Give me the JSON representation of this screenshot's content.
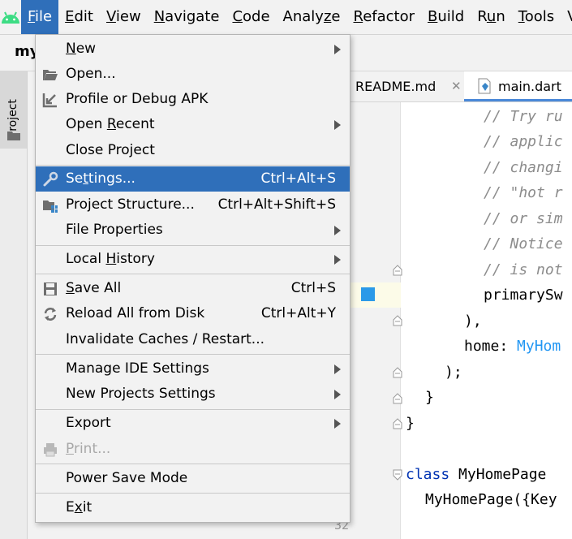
{
  "menubar": {
    "items": [
      {
        "pre": "",
        "mn": "F",
        "post": "ile"
      },
      {
        "pre": "",
        "mn": "E",
        "post": "dit"
      },
      {
        "pre": "",
        "mn": "V",
        "post": "iew"
      },
      {
        "pre": "",
        "mn": "N",
        "post": "avigate"
      },
      {
        "pre": "",
        "mn": "C",
        "post": "ode"
      },
      {
        "pre": "Analy",
        "mn": "z",
        "post": "e"
      },
      {
        "pre": "",
        "mn": "R",
        "post": "efactor"
      },
      {
        "pre": "",
        "mn": "B",
        "post": "uild"
      },
      {
        "pre": "R",
        "mn": "u",
        "post": "n"
      },
      {
        "pre": "",
        "mn": "T",
        "post": "ools"
      },
      {
        "pre": "VC",
        "mn": "",
        "post": ""
      }
    ]
  },
  "toolbar": {
    "project_name": "my"
  },
  "tool_strip": {
    "project_tab": "Project"
  },
  "tabs": {
    "readme": "README.md",
    "readme_close": "✕",
    "main": "main.dart"
  },
  "gutter": {
    "line_numbers": [
      "32"
    ]
  },
  "code": {
    "lines": [
      "// Try ru",
      "// applic",
      "// changi",
      "// \"hot r",
      "// or sim",
      "// Notice",
      "// is not",
      "primarySw",
      "),",
      "home: ",
      ");",
      "}",
      "}",
      "class",
      " MyHomePage",
      "MyHomePage({Key"
    ],
    "home_value": "MyHom"
  },
  "file_menu": {
    "items": [
      {
        "pre": "",
        "mn": "N",
        "post": "ew",
        "shortcut": "",
        "submenu": true
      },
      {
        "pre": "",
        "mn": "",
        "post": "Open...",
        "shortcut": "",
        "submenu": false
      },
      {
        "pre": "",
        "mn": "",
        "post": "Profile or Debug APK",
        "shortcut": "",
        "submenu": false
      },
      {
        "pre": "Open ",
        "mn": "R",
        "post": "ecent",
        "shortcut": "",
        "submenu": true
      },
      {
        "pre": "Close Project",
        "mn": "",
        "post": "",
        "shortcut": "",
        "submenu": false
      },
      {
        "pre": "Se",
        "mn": "t",
        "post": "tings...",
        "shortcut": "Ctrl+Alt+S",
        "submenu": false
      },
      {
        "pre": "Project Structure...",
        "mn": "",
        "post": "",
        "shortcut": "Ctrl+Alt+Shift+S",
        "submenu": false
      },
      {
        "pre": "File Properties",
        "mn": "",
        "post": "",
        "shortcut": "",
        "submenu": true
      },
      {
        "pre": "Local ",
        "mn": "H",
        "post": "istory",
        "shortcut": "",
        "submenu": true
      },
      {
        "pre": "",
        "mn": "S",
        "post": "ave All",
        "shortcut": "Ctrl+S",
        "submenu": false
      },
      {
        "pre": "Reload All from Disk",
        "mn": "",
        "post": "",
        "shortcut": "Ctrl+Alt+Y",
        "submenu": false
      },
      {
        "pre": "Invalidate Caches / Restart...",
        "mn": "",
        "post": "",
        "shortcut": "",
        "submenu": false
      },
      {
        "pre": "Manage IDE Settings",
        "mn": "",
        "post": "",
        "shortcut": "",
        "submenu": true
      },
      {
        "pre": "New Projects Settings",
        "mn": "",
        "post": "",
        "shortcut": "",
        "submenu": true
      },
      {
        "pre": "Export",
        "mn": "",
        "post": "",
        "shortcut": "",
        "submenu": true
      },
      {
        "pre": "",
        "mn": "P",
        "post": "rint...",
        "shortcut": "",
        "submenu": false
      },
      {
        "pre": "Power Save Mode",
        "mn": "",
        "post": "",
        "shortcut": "",
        "submenu": false
      },
      {
        "pre": "E",
        "mn": "x",
        "post": "it",
        "shortcut": "",
        "submenu": false
      }
    ]
  },
  "colors": {
    "accent": "#2f6fba",
    "breakpoint": "#2b9ae8"
  }
}
